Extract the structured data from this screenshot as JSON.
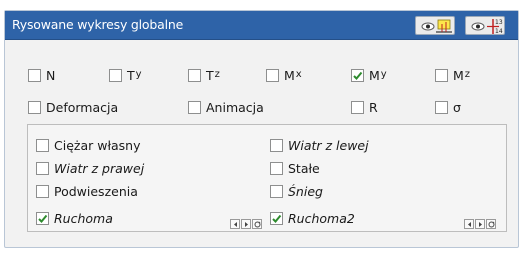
{
  "panel": {
    "title": "Rysowane wykresy globalne",
    "forces": [
      {
        "main": "N",
        "sub": "",
        "checked": false
      },
      {
        "main": "T",
        "sub": "y",
        "checked": false
      },
      {
        "main": "T",
        "sub": "z",
        "checked": false
      },
      {
        "main": "M",
        "sub": "x",
        "checked": false
      },
      {
        "main": "M",
        "sub": "y",
        "checked": true
      },
      {
        "main": "M",
        "sub": "z",
        "checked": false
      }
    ],
    "options": [
      {
        "label": "Deformacja",
        "checked": false
      },
      {
        "label": "Animacja",
        "checked": false
      },
      {
        "label": "R",
        "checked": false
      },
      {
        "label": "σ",
        "checked": false
      }
    ],
    "loads": [
      {
        "label": "Ciężar własny",
        "checked": false,
        "italic": false
      },
      {
        "label": "Wiatr z lewej",
        "checked": false,
        "italic": true
      },
      {
        "label": "Wiatr z prawej",
        "checked": false,
        "italic": true
      },
      {
        "label": "Stałe",
        "checked": false,
        "italic": false
      },
      {
        "label": "Podwieszenia",
        "checked": false,
        "italic": false
      },
      {
        "label": "Śnieg",
        "checked": false,
        "italic": true
      },
      {
        "label": "Ruchoma",
        "checked": true,
        "italic": true
      },
      {
        "label": "Ruchoma2",
        "checked": true,
        "italic": true
      }
    ],
    "header_buttons": [
      {
        "icon": "eye-diagram-icon"
      },
      {
        "icon": "eye-numbers-icon",
        "text": "13 14"
      }
    ],
    "colors": {
      "titlebar": "#2e63a8",
      "check": "#2e8b2e",
      "panel": "#f2f2f2"
    }
  }
}
